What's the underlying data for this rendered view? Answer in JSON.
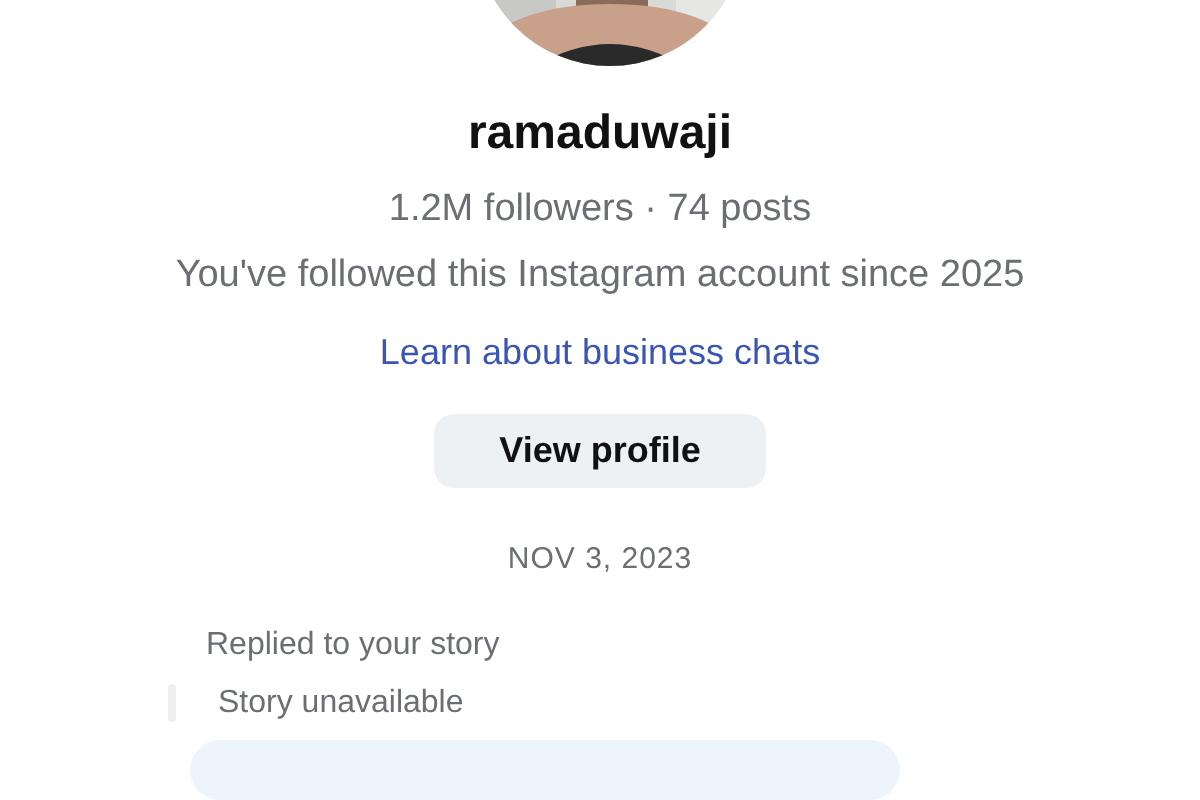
{
  "profile": {
    "username": "ramaduwaji",
    "stats": "1.2M followers · 74 posts",
    "follow_note": "You've followed this Instagram account since 2025",
    "link": "Learn about business chats",
    "button": "View profile"
  },
  "date": "NOV 3, 2023",
  "reply": {
    "label": "Replied to your story",
    "quote": "Story unavailable"
  }
}
